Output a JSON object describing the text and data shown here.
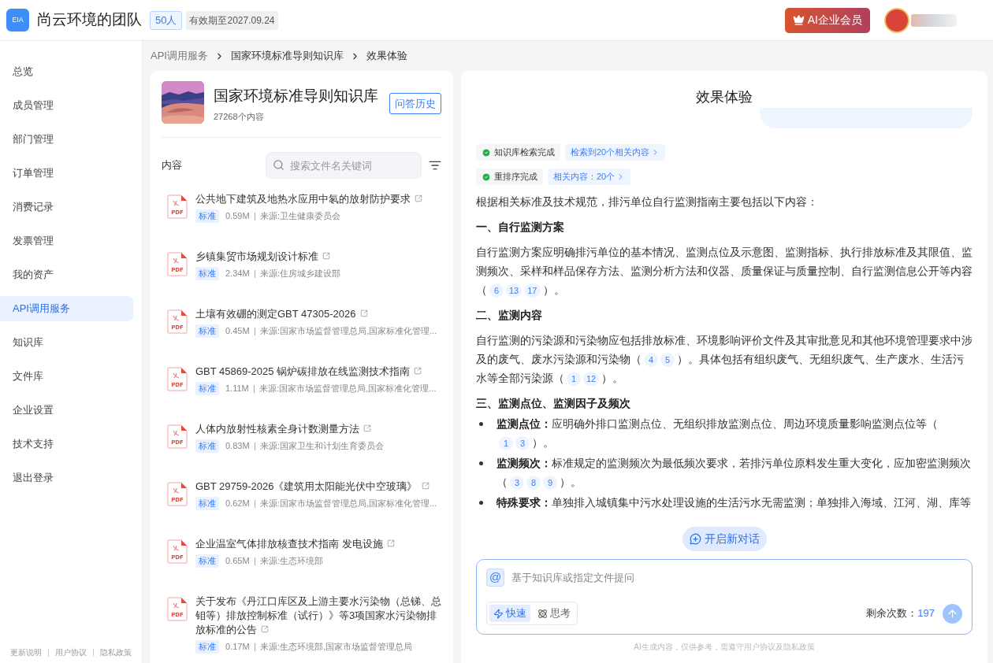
{
  "header": {
    "team_name": "尚云环境的团队",
    "logo_text": "EIA",
    "member_badge": "50人",
    "validity": "有效期至2027.09.24",
    "vip_button": "AI企业会员"
  },
  "sidebar": {
    "items": [
      {
        "label": "总览",
        "selected": false
      },
      {
        "label": "成员管理",
        "selected": false
      },
      {
        "label": "部门管理",
        "selected": false
      },
      {
        "label": "订单管理",
        "selected": false
      },
      {
        "label": "消费记录",
        "selected": false
      },
      {
        "label": "发票管理",
        "selected": false
      },
      {
        "label": "我的资产",
        "selected": false
      },
      {
        "label": "API调用服务",
        "selected": true
      },
      {
        "label": "知识库",
        "selected": false
      },
      {
        "label": "文件库",
        "selected": false
      },
      {
        "label": "企业设置",
        "selected": false
      },
      {
        "label": "技术支持",
        "selected": false
      },
      {
        "label": "退出登录",
        "selected": false
      }
    ],
    "footer_links": [
      "更新说明",
      "用户协议",
      "隐私政策"
    ]
  },
  "breadcrumb": [
    "API调用服务",
    "国家环境标准导则知识库",
    "效果体验"
  ],
  "knowledge_base": {
    "title": "国家环境标准导则知识库",
    "count": "27268个内容",
    "history_button": "问答历史",
    "section_label": "内容",
    "search": {
      "placeholder": "搜索文件名关键词"
    },
    "documents": [
      {
        "file_type": "PDF",
        "title": "公共地下建筑及地热水应用中氡的放射防护要求",
        "tag": "标准",
        "size": "0.59M",
        "source": "来源:卫生健康委员会"
      },
      {
        "file_type": "PDF",
        "title": "乡镇集贸市场规划设计标准",
        "tag": "标准",
        "size": "2.34M",
        "source": "来源:住房城乡建设部"
      },
      {
        "file_type": "PDF",
        "title": "土壤有效硼的测定GBT 47305-2026",
        "tag": "标准",
        "size": "0.45M",
        "source": "来源:国家市场监督管理总局,国家标准化管理..."
      },
      {
        "file_type": "PDF",
        "title": "GBT 45869-2025 锅炉碳排放在线监测技术指南",
        "tag": "标准",
        "size": "1.11M",
        "source": "来源:国家市场监督管理总局,国家标准化管理..."
      },
      {
        "file_type": "PDF",
        "title": "人体内放射性核素全身计数测量方法",
        "tag": "标准",
        "size": "0.83M",
        "source": "来源:国家卫生和计划生育委员会"
      },
      {
        "file_type": "PDF",
        "title": "GBT 29759-2026《建筑用太阳能光伏中空玻璃》",
        "tag": "标准",
        "size": "0.62M",
        "source": "来源:国家市场监督管理总局,国家标准化管理..."
      },
      {
        "file_type": "PDF",
        "title": "企业温室气体排放核查技术指南 发电设施",
        "tag": "标准",
        "size": "0.65M",
        "source": "来源:生态环境部"
      },
      {
        "file_type": "PDF",
        "title": "关于发布《丹江口库区及上游主要水污染物（总锑、总钼等）排放控制标准（试行）》等3项国家水污染物排放标准的公告",
        "tag": "标准",
        "size": "0.17M",
        "source": "来源:生态环境部,国家市场监督管理总局"
      }
    ]
  },
  "chat": {
    "title": "效果体验",
    "status": [
      {
        "label": "知识库检索完成",
        "link": "检索到20个相关内容"
      },
      {
        "label": "重排序完成",
        "link": "相关内容：20个"
      }
    ],
    "answer": [
      {
        "kind": "paragraph",
        "parts": [
          {
            "kind": "text",
            "text": "根据相关标准及技术规范，排污单位自行监测指南主要包括以下内容："
          }
        ]
      },
      {
        "kind": "heading",
        "text": "一、自行监测方案"
      },
      {
        "kind": "paragraph",
        "parts": [
          {
            "kind": "text",
            "text": "自行监测方案应明确排污单位的基本情况、监测点位及示意图、监测指标、执行排放标准及其限值、监测频次、采样和样品保存方法、监测分析方法和仪器、质量保证与质量控制、自行监测信息公开等内容（"
          },
          {
            "kind": "refs",
            "refs": [
              "6",
              "13",
              "17"
            ]
          },
          {
            "kind": "text",
            "text": "）。"
          }
        ]
      },
      {
        "kind": "heading",
        "text": "二、监测内容"
      },
      {
        "kind": "paragraph",
        "parts": [
          {
            "kind": "text",
            "text": "自行监测的污染源和污染物应包括排放标准、环境影响评价文件及其审批意见和其他环境管理要求中涉及的废气、废水污染源和污染物（"
          },
          {
            "kind": "refs",
            "refs": [
              "4",
              "5"
            ]
          },
          {
            "kind": "text",
            "text": "）。具体包括有组织废气、无组织废气、生产废水、生活污水等全部污染源（"
          },
          {
            "kind": "refs",
            "refs": [
              "1",
              "12"
            ]
          },
          {
            "kind": "text",
            "text": "）。"
          }
        ]
      },
      {
        "kind": "heading",
        "text": "三、监测点位、监测因子及频次"
      },
      {
        "kind": "bullet",
        "label": "监测点位：",
        "parts": [
          {
            "kind": "text",
            "text": "应明确外排口监测点位、无组织排放监测点位、周边环境质量影响监测点位等（"
          },
          {
            "kind": "refs",
            "refs": [
              "1",
              "3"
            ]
          },
          {
            "kind": "text",
            "text": "）。"
          }
        ]
      },
      {
        "kind": "bullet",
        "label": "监测频次：",
        "parts": [
          {
            "kind": "text",
            "text": "标准规定的监测频次为最低频次要求，若排污单位原料发生重大变化，应加密监测频次（"
          },
          {
            "kind": "refs",
            "refs": [
              "3",
              "8",
              "9"
            ]
          },
          {
            "kind": "text",
            "text": "）。"
          }
        ]
      },
      {
        "kind": "bullet",
        "label": "特殊要求：",
        "parts": [
          {
            "kind": "text",
            "text": "单独排入城镇集中污水处理设施的生活污水无需监测；单独排入海域、江河、湖、库等"
          }
        ]
      }
    ],
    "new_chat_button": "开启新对话",
    "input": {
      "placeholder": "基于知识库或指定文件提问",
      "at_button": "@",
      "modes": [
        {
          "label": "快速",
          "selected": true
        },
        {
          "label": "思考",
          "selected": false
        }
      ],
      "remaining_label": "剩余次数：",
      "remaining_value": "197"
    },
    "disclaimer": "AI生成内容，仅供参考，需遵守用户协议及隐私政策"
  }
}
